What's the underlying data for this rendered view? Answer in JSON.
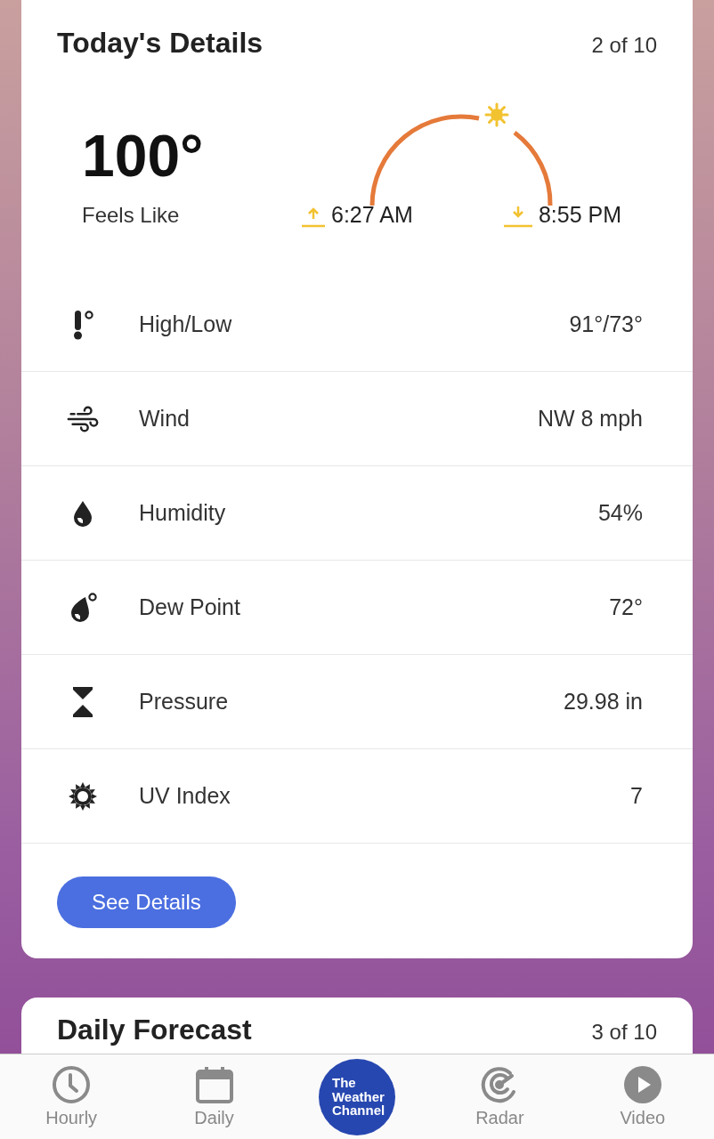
{
  "details_card": {
    "title": "Today's Details",
    "page": "2 of 10",
    "feels_like": {
      "value": "100°",
      "label": "Feels Like"
    },
    "sunrise": "6:27 AM",
    "sunset": "8:55 PM",
    "rows": [
      {
        "kind": "thermometer",
        "label": "High/Low",
        "value": "91°/73°"
      },
      {
        "kind": "wind",
        "label": "Wind",
        "value": "NW 8 mph"
      },
      {
        "kind": "drop",
        "label": "Humidity",
        "value": "54%"
      },
      {
        "kind": "dewpoint",
        "label": "Dew Point",
        "value": "72°"
      },
      {
        "kind": "pressure",
        "label": "Pressure",
        "value": "29.98 in"
      },
      {
        "kind": "uv",
        "label": "UV Index",
        "value": "7"
      }
    ],
    "button": "See Details"
  },
  "forecast_card": {
    "title": "Daily Forecast",
    "page": "3 of 10"
  },
  "tab_bar": [
    {
      "kind": "clock",
      "label": "Hourly"
    },
    {
      "kind": "calendar",
      "label": "Daily"
    },
    {
      "kind": "logo",
      "lines": [
        "The",
        "Weather",
        "Channel"
      ]
    },
    {
      "kind": "radar",
      "label": "Radar"
    },
    {
      "kind": "play",
      "label": "Video"
    }
  ]
}
